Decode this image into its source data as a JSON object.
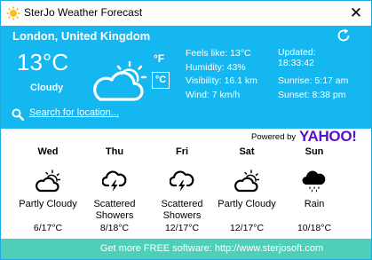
{
  "window": {
    "title": "SterJo Weather Forecast",
    "close_glyph": "✕"
  },
  "current": {
    "location": "London, United Kingdom",
    "temperature": "13°C",
    "condition": "Cloudy",
    "unit_f": "°F",
    "unit_c": "°C",
    "feels_like": "Feels like: 13°C",
    "humidity": "Humidity: 43%",
    "visibility": "Visibility: 16.1 km",
    "wind": "Wind: 7 km/h",
    "updated_label": "Updated:",
    "updated_time": "18:33:42",
    "sunrise": "Sunrise: 5:17 am",
    "sunset": "Sunset: 8:38 pm",
    "icon": "partly-cloudy-icon"
  },
  "search": {
    "label": "Search for location..."
  },
  "powered_by": {
    "label": "Powered by",
    "brand": "YAHOO!"
  },
  "forecast": [
    {
      "day": "Wed",
      "condition": "Partly Cloudy",
      "temp": "6/17°C",
      "icon": "partly-cloudy-icon"
    },
    {
      "day": "Thu",
      "condition": "Scattered Showers",
      "temp": "8/18°C",
      "icon": "thunder-cloud-icon"
    },
    {
      "day": "Fri",
      "condition": "Scattered Showers",
      "temp": "12/17°C",
      "icon": "thunder-cloud-icon"
    },
    {
      "day": "Sat",
      "condition": "Partly Cloudy",
      "temp": "12/17°C",
      "icon": "partly-cloudy-icon"
    },
    {
      "day": "Sun",
      "condition": "Rain",
      "temp": "10/18°C",
      "icon": "rain-cloud-icon"
    }
  ],
  "footer": {
    "text": "Get more FREE software: http://www.sterjosoft.com"
  },
  "colors": {
    "panel": "#14b7f0",
    "footer": "#4fcfb9",
    "yahoo": "#5a0fc8"
  }
}
